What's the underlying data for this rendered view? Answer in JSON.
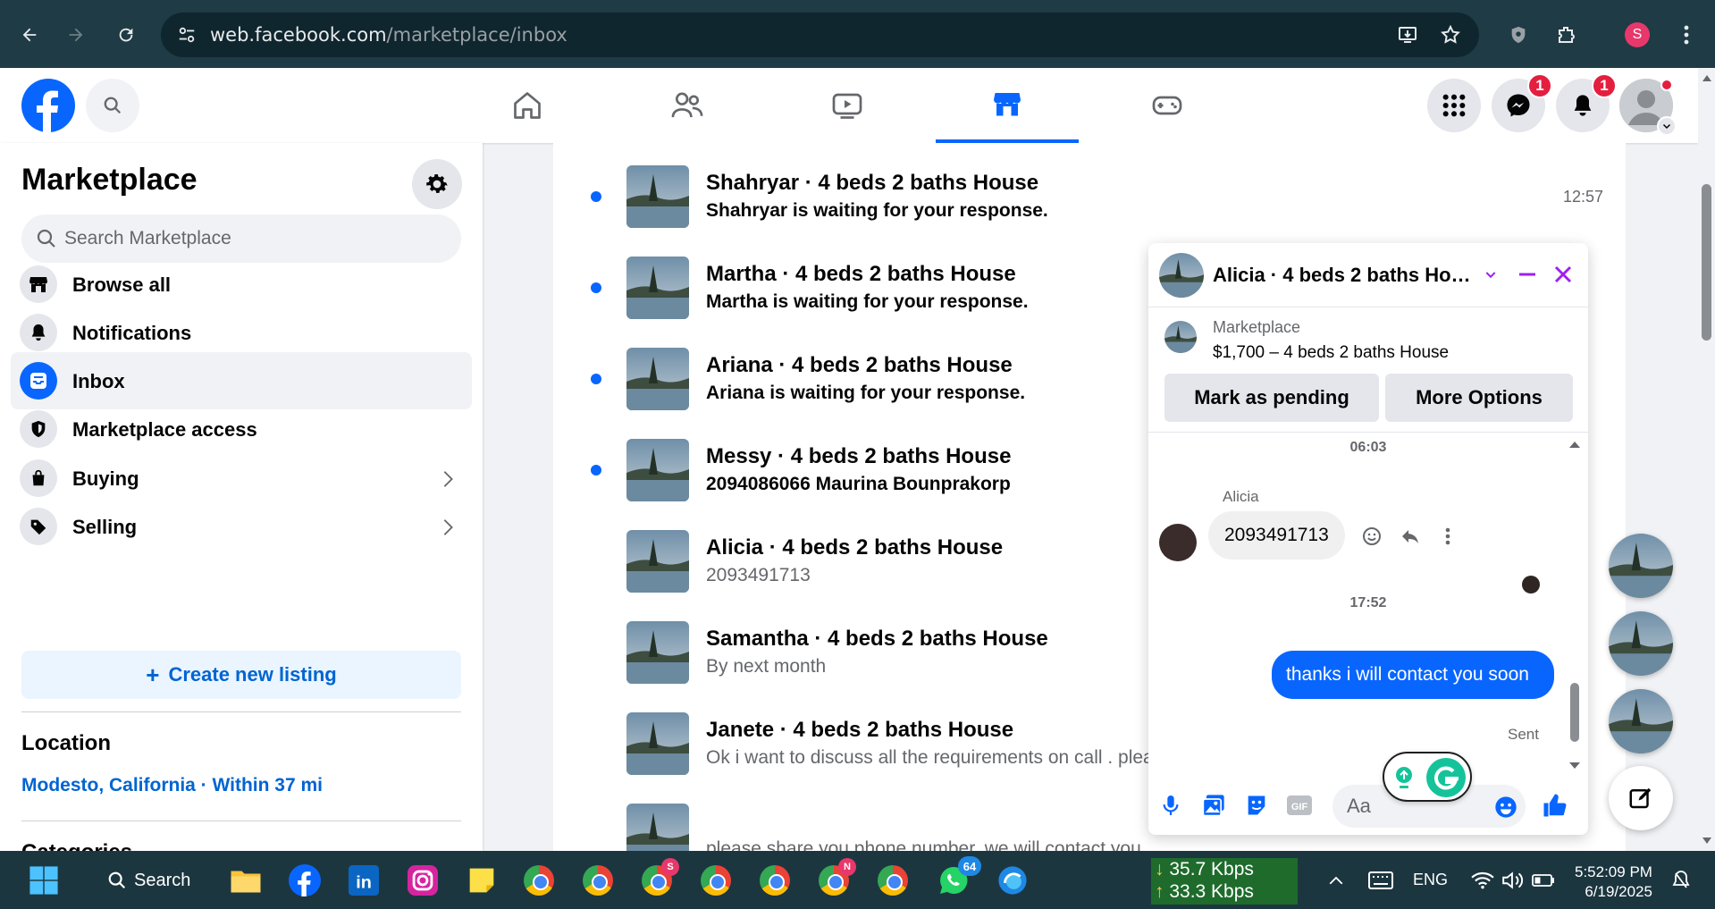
{
  "browser": {
    "url_host": "web.facebook.com",
    "url_path": "/marketplace/inbox",
    "profile_initial": "S"
  },
  "topbar": {
    "messenger_badge": "1",
    "notifications_badge": "1"
  },
  "sidebar": {
    "title": "Marketplace",
    "search_placeholder": "Search Marketplace",
    "items": [
      {
        "label": "Browse all"
      },
      {
        "label": "Notifications"
      },
      {
        "label": "Inbox"
      },
      {
        "label": "Marketplace access"
      },
      {
        "label": "Buying"
      },
      {
        "label": "Selling"
      }
    ],
    "create_listing": "Create new listing",
    "location_title": "Location",
    "location_value": "Modesto, California · Within 37 mi",
    "categories_title": "Categories"
  },
  "inbox": {
    "conversations": [
      {
        "name": "Shahryar · 4 beds 2 baths House",
        "preview": "Shahryar is waiting for your response.",
        "time": "12:57",
        "unread": true
      },
      {
        "name": "Martha · 4 beds 2 baths House",
        "preview": "Martha is waiting for your response.",
        "unread": true
      },
      {
        "name": "Ariana · 4 beds 2 baths House",
        "preview": "Ariana is waiting for your response.",
        "unread": true
      },
      {
        "name": "Messy · 4 beds 2 baths House",
        "preview": "2094086066 Maurina Bounprakorp",
        "unread": true
      },
      {
        "name": "Alicia · 4 beds 2 baths House",
        "preview": "2093491713",
        "unread": false
      },
      {
        "name": "Samantha · 4 beds 2 baths House",
        "preview": "By next month",
        "unread": false
      },
      {
        "name": "Janete · 4 beds 2 baths House",
        "preview": "Ok i want to discuss all the requirements on call . please",
        "unread": false
      },
      {
        "name": "",
        "preview": "please share you phone number, we will contact you",
        "unread": false
      }
    ]
  },
  "chat": {
    "title": "Alicia · 4 beds 2 baths Hou...",
    "listing_label": "Marketplace",
    "listing_price": "$1,700 – 4 beds 2 baths House",
    "mark_pending": "Mark as pending",
    "more_options": "More Options",
    "timestamp_1": "06:03",
    "incoming_sender": "Alicia",
    "incoming_message": "2093491713",
    "timestamp_2": "17:52",
    "outgoing_message": "thanks i will contact you soon",
    "sent_label": "Sent",
    "input_placeholder": "Aa"
  },
  "taskbar": {
    "search_label": "Search",
    "whatsapp_badge": "64",
    "net_down": "35.7 Kbps",
    "net_up": "33.3 Kbps",
    "language": "ENG",
    "time": "5:52:09 PM",
    "date": "6/19/2025"
  },
  "colors": {
    "accent": "#0866ff",
    "chat_close": "#a020f0"
  }
}
